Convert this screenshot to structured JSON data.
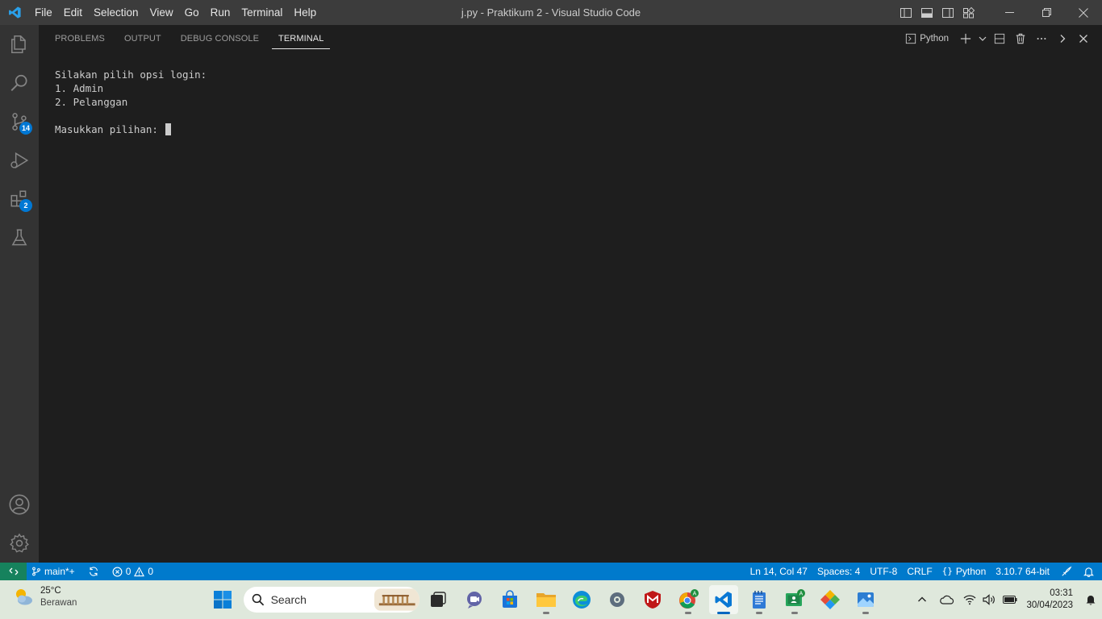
{
  "titlebar": {
    "menu": [
      "File",
      "Edit",
      "Selection",
      "View",
      "Go",
      "Run",
      "Terminal",
      "Help"
    ],
    "window_title": "j.py - Praktikum 2 - Visual Studio Code"
  },
  "activitybar": {
    "items": [
      "explorer-icon",
      "search-icon",
      "source-control-icon",
      "run-debug-icon",
      "extensions-icon",
      "testing-icon"
    ],
    "source_control_badge": "14",
    "extensions_badge": "2",
    "bottom": [
      "accounts-icon",
      "manage-gear-icon"
    ]
  },
  "panel": {
    "tabs": [
      "PROBLEMS",
      "OUTPUT",
      "DEBUG CONSOLE",
      "TERMINAL"
    ],
    "active_tab": "TERMINAL",
    "terminal_profile": "Python",
    "terminal_lines": [
      "Silakan pilih opsi login:",
      "1. Admin",
      "2. Pelanggan",
      "",
      "Masukkan pilihan: "
    ]
  },
  "statusbar": {
    "branch": "main*+",
    "errors": "0",
    "warnings": "0",
    "cursor_position": "Ln 14, Col 47",
    "indentation": "Spaces: 4",
    "encoding": "UTF-8",
    "eol": "CRLF",
    "language": "Python",
    "interpreter": "3.10.7 64-bit"
  },
  "taskbar": {
    "weather_temp": "25°C",
    "weather_desc": "Berawan",
    "search_placeholder": "Search",
    "time": "03:31",
    "date": "30/04/2023"
  },
  "colors": {
    "titlebar": "#3c3c3c",
    "activitybar": "#333333",
    "panel": "#1e1e1e",
    "statusbar": "#007acc",
    "remote": "#16825d",
    "taskbar": "#dfe8dc",
    "badge": "#0078d4"
  }
}
